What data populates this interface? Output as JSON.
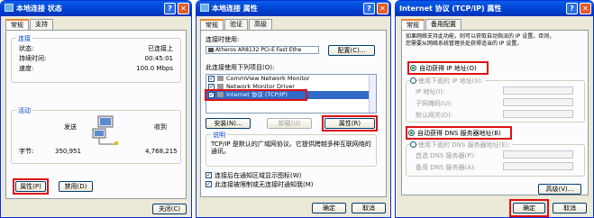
{
  "win1": {
    "title": "本地连接 状态",
    "help": "?",
    "close": "✕",
    "tabs": [
      "常规",
      "支持"
    ],
    "connection": {
      "group": "连接",
      "status_label": "状态:",
      "status_value": "已连接上",
      "duration_label": "持续时间:",
      "duration_value": "00:45:01",
      "speed_label": "速度:",
      "speed_value": "100.0 Mbps"
    },
    "activity": {
      "group": "活动",
      "sent": "发送",
      "received": "收到",
      "bytes_label": "字节:",
      "bytes_sent": "350,951",
      "bytes_recv": "4,768,215"
    },
    "props_btn": "属性(P)",
    "disable_btn": "禁用(D)",
    "close_btn": "关闭(C)"
  },
  "win2": {
    "title": "本地连接 属性",
    "help": "?",
    "close": "✕",
    "tabs": [
      "常规",
      "验证",
      "高级"
    ],
    "connect_using": "连接时使用:",
    "adapter": "Atheros AR8132 PCI-E Fast Ethe",
    "configure_btn": "配置(C)...",
    "items_label": "此连接使用下列项目(O):",
    "items": [
      "CommView Network Monitor",
      "Network Monitor Driver",
      "Internet 协议 (TCP/IP)"
    ],
    "install_btn": "安装(N)...",
    "uninstall_btn": "卸载(U)",
    "props_btn": "属性(R)",
    "desc_group": "说明",
    "desc_text": "TCP/IP 是默认的广域网协议。它提供跨越多种互联网络的通讯。",
    "show_icon": "连接后在通知区域显示图标(W)",
    "notify": "此连接被限制或无连接时通知我(M)",
    "ok_btn": "确定",
    "cancel_btn": "取消"
  },
  "win3": {
    "title": "Internet 协议 (TCP/IP) 属性",
    "help": "?",
    "close": "✕",
    "tabs": [
      "常规",
      "备用配置"
    ],
    "intro_line1": "如果网络支持此功能，则可以获取自动指派的 IP 设置。否则，",
    "intro_line2": "您需要从网络系统管理员处获得适当的 IP 设置。",
    "auto_ip": "自动获得 IP 地址(O)",
    "manual_ip": "使用下面的 IP 地址(S):",
    "ip_label": "IP 地址(I):",
    "mask_label": "子网掩码(U):",
    "gw_label": "默认网关(D):",
    "auto_dns": "自动获得 DNS 服务器地址(B)",
    "manual_dns": "使用下面的 DNS 服务器地址(E):",
    "dns1_label": "首选 DNS 服务器(P):",
    "dns2_label": "备用 DNS 服务器(A):",
    "advanced_btn": "高级(V)...",
    "ok_btn": "确定",
    "cancel_btn": "取消"
  },
  "colors": {
    "highlight": "#e01010",
    "titlebar": "#0045d8"
  }
}
